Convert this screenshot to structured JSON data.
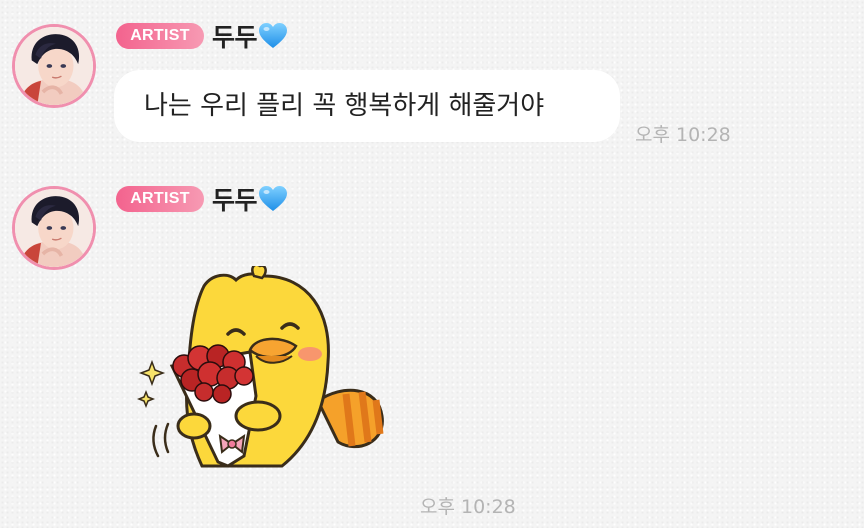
{
  "chat": {
    "messages": [
      {
        "badge": "ARTIST",
        "sender": "두두",
        "text": "나는 우리 플리 꼭 행복하게 해줄거야",
        "time": "오후 10:28"
      },
      {
        "badge": "ARTIST",
        "sender": "두두",
        "sticker": "yellow-duck-with-rose-bouquet-sticker",
        "time": "오후 10:28"
      }
    ]
  },
  "colors": {
    "badge_start": "#f3638e",
    "badge_end": "#f79ab3",
    "avatar_ring": "#f08fae",
    "heart": "#3aa8f5",
    "timestamp": "#b4b4b4",
    "bubble": "#ffffff"
  }
}
